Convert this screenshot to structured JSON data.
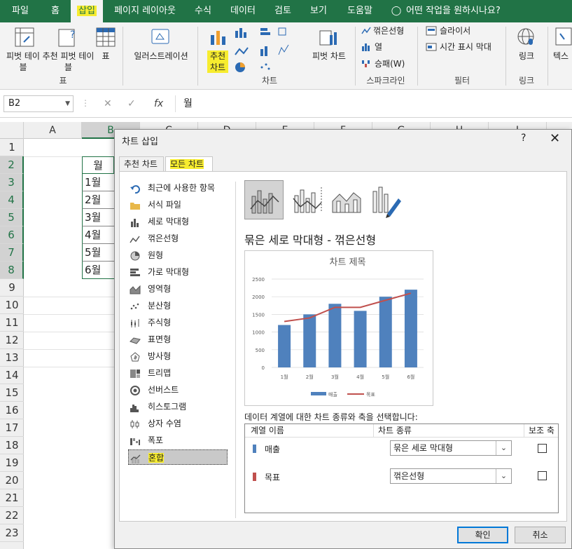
{
  "ribbon_tabs": [
    "파일",
    "홈",
    "삽입",
    "페이지 레이아웃",
    "수식",
    "데이터",
    "검토",
    "보기",
    "도움말"
  ],
  "tell_me": "어떤 작업을 원하시나요?",
  "ribbon": {
    "pivot_table": "피벗 테이블",
    "recommended_pivot": "추천 피벗 테이블",
    "table": "표",
    "group_table": "표",
    "illustrations": "일러스트레이션",
    "recommended_charts_1": "추천",
    "recommended_charts_2": "차트",
    "pivot_chart": "피벗 차트",
    "group_charts": "차트",
    "spark_line": "꺾은선형",
    "spark_column": "열",
    "spark_winloss": "승패(W)",
    "group_sparklines": "스파크라인",
    "slicer": "슬라이서",
    "timeline": "시간 표시 막대",
    "group_filter": "필터",
    "link": "링크",
    "group_links": "링크",
    "text": "텍스"
  },
  "formula_bar": {
    "name_box": "B2",
    "fx": "fx",
    "value": "월"
  },
  "sheet": {
    "columns": [
      "A",
      "B",
      "C",
      "D",
      "E",
      "F",
      "G",
      "H",
      "I"
    ],
    "rows": [
      "1",
      "2",
      "3",
      "4",
      "5",
      "6",
      "7",
      "8",
      "9",
      "10",
      "11",
      "12",
      "13",
      "14",
      "15",
      "16",
      "17",
      "18",
      "19",
      "20",
      "21",
      "22",
      "23"
    ],
    "cells_b": [
      "월",
      "1월",
      "2월",
      "3월",
      "4월",
      "5월",
      "6월"
    ]
  },
  "dialog": {
    "title": "차트 삽입",
    "help": "?",
    "close": "✕",
    "tabs": [
      "추천 차트",
      "모든 차트"
    ],
    "chart_types": [
      {
        "label": "최근에 사용한 항목",
        "icon": "undo-icon"
      },
      {
        "label": "서식 파일",
        "icon": "folder-icon"
      },
      {
        "label": "세로 막대형",
        "icon": "column-chart-icon"
      },
      {
        "label": "꺾은선형",
        "icon": "line-chart-icon"
      },
      {
        "label": "원형",
        "icon": "pie-chart-icon"
      },
      {
        "label": "가로 막대형",
        "icon": "bar-chart-icon"
      },
      {
        "label": "영역형",
        "icon": "area-chart-icon"
      },
      {
        "label": "분산형",
        "icon": "scatter-chart-icon"
      },
      {
        "label": "주식형",
        "icon": "stock-chart-icon"
      },
      {
        "label": "표면형",
        "icon": "surface-chart-icon"
      },
      {
        "label": "방사형",
        "icon": "radar-chart-icon"
      },
      {
        "label": "트리맵",
        "icon": "treemap-icon"
      },
      {
        "label": "선버스트",
        "icon": "sunburst-icon"
      },
      {
        "label": "히스토그램",
        "icon": "histogram-icon"
      },
      {
        "label": "상자 수염",
        "icon": "box-whisker-icon"
      },
      {
        "label": "폭포",
        "icon": "waterfall-icon"
      },
      {
        "label": "혼합",
        "icon": "combo-chart-icon"
      }
    ],
    "selected_type": "혼합",
    "subtype_title": "묶은 세로 막대형 - 꺾은선형",
    "series_prompt": "데이터 계열에 대한 차트 종류와 축을 선택합니다:",
    "table_headers": [
      "계열 이름",
      "차트 종류",
      "보조 축"
    ],
    "series": [
      {
        "name": "매출",
        "chart_type": "묶은 세로 막대형",
        "secondary_axis": false,
        "color": "#4f81bd"
      },
      {
        "name": "목표",
        "chart_type": "꺾은선형",
        "secondary_axis": false,
        "color": "#c0504d"
      }
    ],
    "ok": "확인",
    "cancel": "취소"
  },
  "chart_data": {
    "type": "bar",
    "title": "차트 제목",
    "categories": [
      "1월",
      "2월",
      "3월",
      "4월",
      "5월",
      "6월"
    ],
    "series": [
      {
        "name": "매출",
        "type": "bar",
        "values": [
          1200,
          1500,
          1800,
          1600,
          2000,
          2200
        ],
        "color": "#4f81bd"
      },
      {
        "name": "목표",
        "type": "line",
        "values": [
          1300,
          1400,
          1700,
          1700,
          1900,
          2100
        ],
        "color": "#c0504d"
      }
    ],
    "ylim": [
      0,
      2500
    ],
    "yticks": [
      0,
      500,
      1000,
      1500,
      2000,
      2500
    ],
    "legend": "bottom",
    "grid": true
  },
  "colors": {
    "excel_green": "#217346",
    "highlight": "#f7ec2f"
  }
}
